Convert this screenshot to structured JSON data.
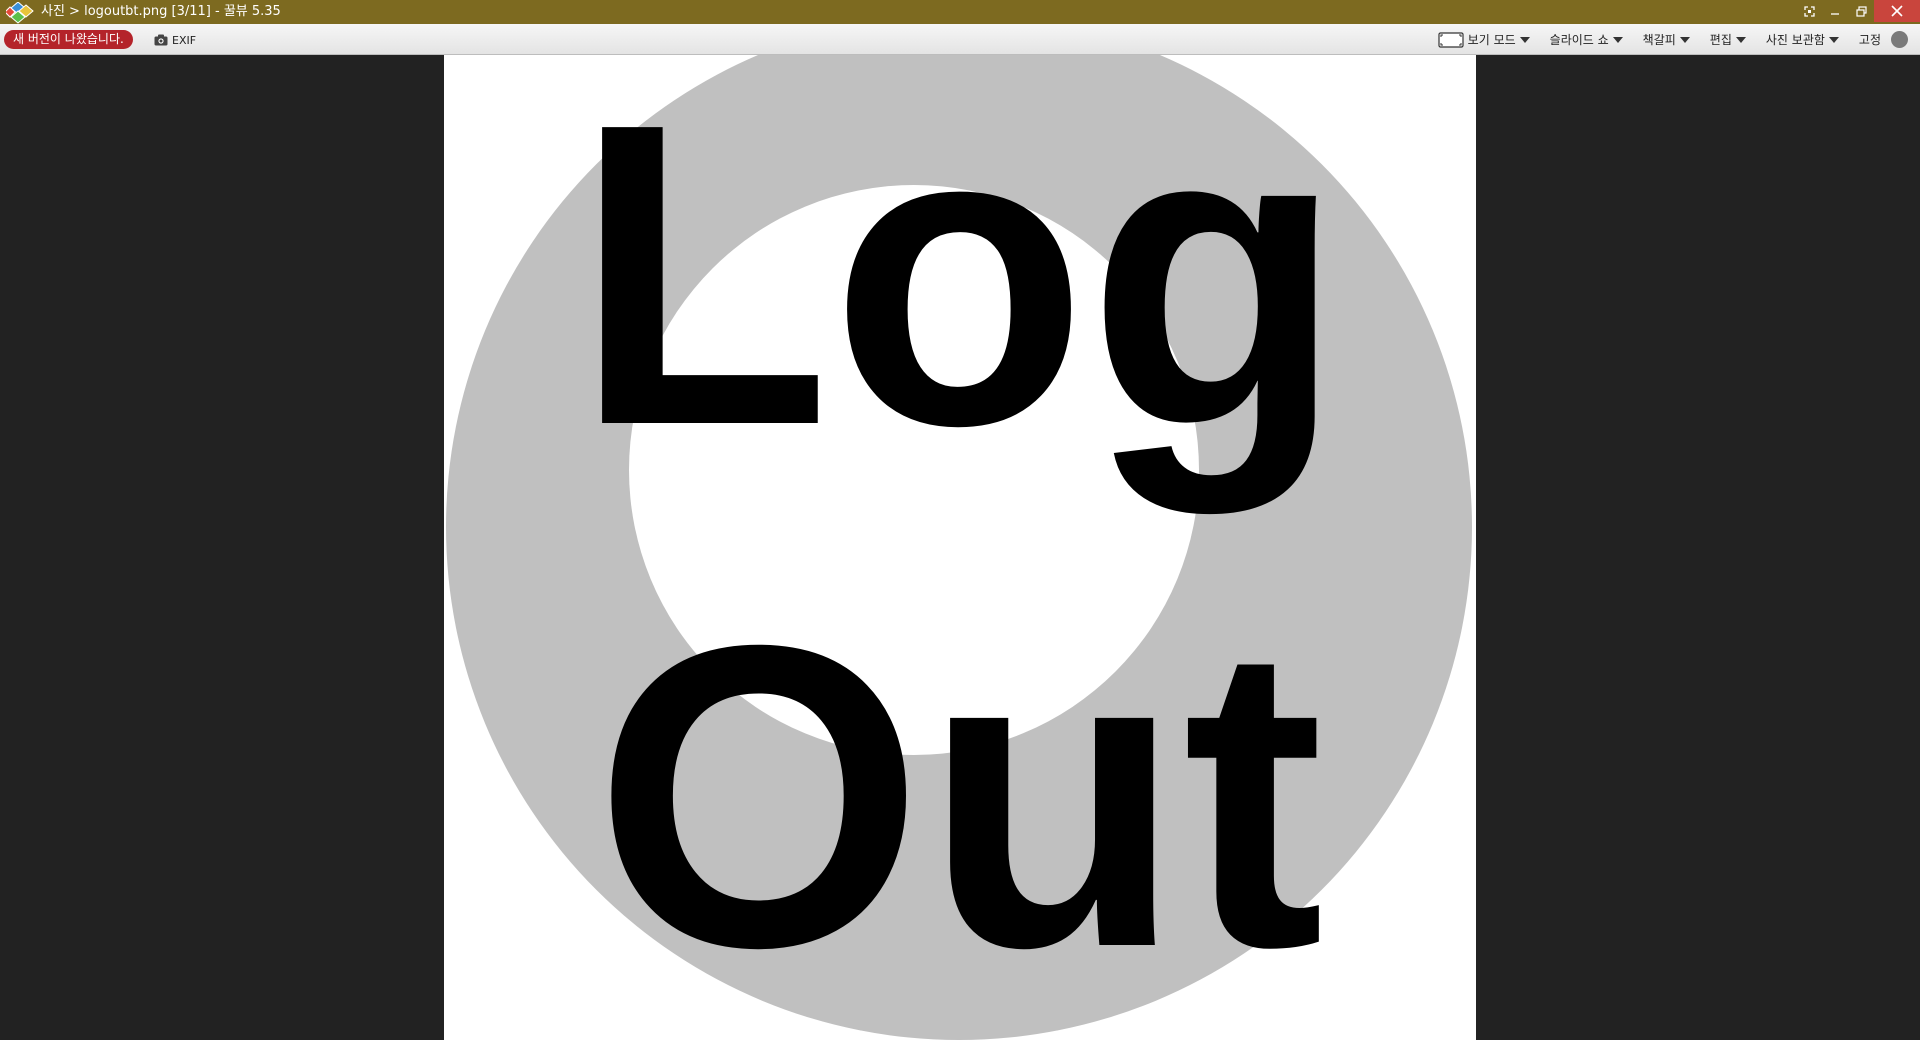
{
  "titlebar": {
    "title": "사진 > logoutbt.png [3/11] - 꿀뷰 5.35",
    "bg_color": "#7d6a20"
  },
  "window_controls": {
    "fullscreen_icon": "fullscreen-icon",
    "minimize_icon": "minimize-icon",
    "restore_icon": "restore-icon",
    "close_icon": "close-icon"
  },
  "toolbar": {
    "update_badge": "새 버전이 나왔습니다.",
    "exif_label": "EXIF",
    "menus": [
      {
        "label": "보기 모드",
        "icon": "view-mode-icon"
      },
      {
        "label": "슬라이드 쇼"
      },
      {
        "label": "책갈피"
      },
      {
        "label": "편집"
      },
      {
        "label": "사진 보관함"
      }
    ],
    "pin_label": "고정"
  },
  "image": {
    "line1": "Log",
    "line2": "Out",
    "ring_color": "#c0c0c0",
    "text_color": "#000000"
  }
}
